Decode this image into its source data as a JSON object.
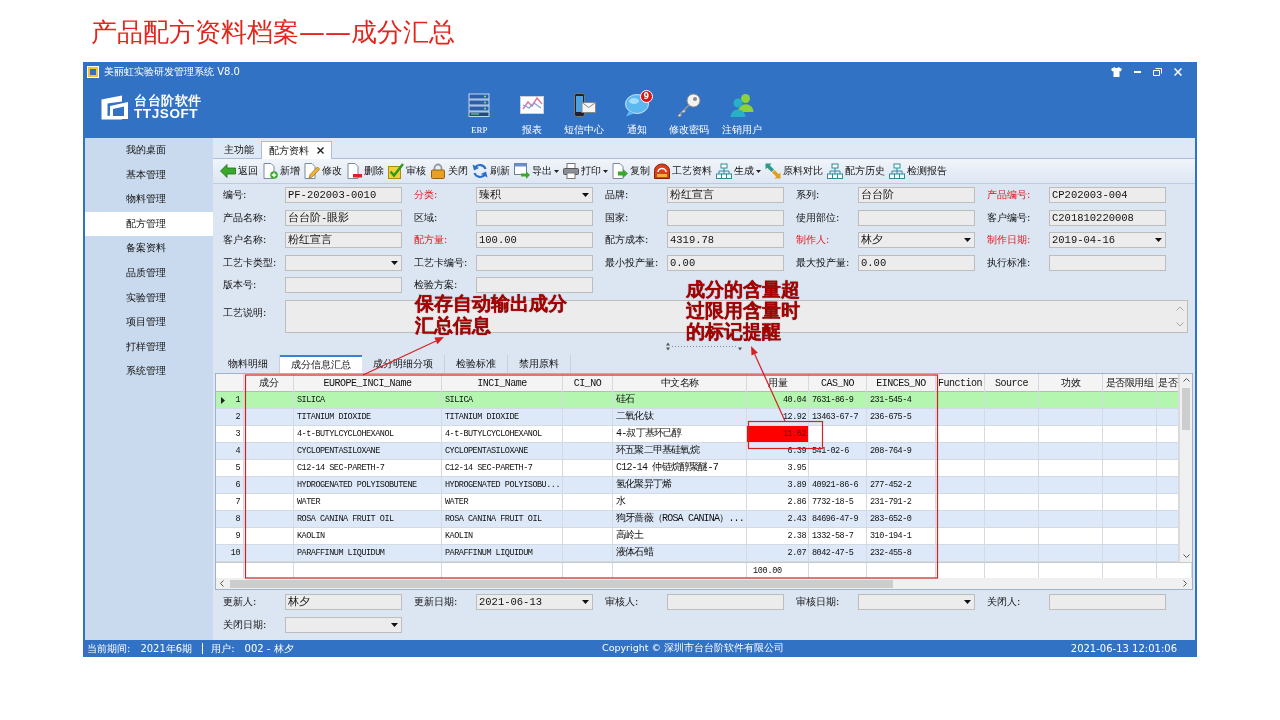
{
  "slide_title": "产品配方资料档案——成分汇总",
  "window": {
    "title": "美丽虹实验研发管理系统 V8.0"
  },
  "header": {
    "logo_name": "台台阶软件",
    "logo_latin": "TTJSOFT",
    "shortcuts": [
      {
        "label": "ERP"
      },
      {
        "label": "报表"
      },
      {
        "label": "短信中心"
      },
      {
        "label": "通知",
        "badge": "9"
      },
      {
        "label": "修改密码"
      },
      {
        "label": "注销用户"
      }
    ]
  },
  "sidebar": {
    "items": [
      {
        "label": "我的桌面",
        "selected": false
      },
      {
        "label": "基本管理",
        "selected": false
      },
      {
        "label": "物料管理",
        "selected": false
      },
      {
        "label": "配方管理",
        "selected": true
      },
      {
        "label": "备案资料",
        "selected": false
      },
      {
        "label": "品质管理",
        "selected": false
      },
      {
        "label": "实验管理",
        "selected": false
      },
      {
        "label": "项目管理",
        "selected": false
      },
      {
        "label": "打样管理",
        "selected": false
      },
      {
        "label": "系统管理",
        "selected": false
      }
    ]
  },
  "tabs": [
    {
      "label": "主功能",
      "selected": false,
      "closable": false
    },
    {
      "label": "配方资料",
      "selected": true,
      "closable": true
    }
  ],
  "toolbar": [
    {
      "label": "返回",
      "dropdown": false
    },
    {
      "label": "新增",
      "dropdown": false
    },
    {
      "label": "修改",
      "dropdown": false
    },
    {
      "label": "删除",
      "dropdown": false
    },
    {
      "label": "审核",
      "dropdown": false
    },
    {
      "label": "关闭",
      "dropdown": false
    },
    {
      "label": "刷新",
      "dropdown": false
    },
    {
      "label": "导出",
      "dropdown": true
    },
    {
      "label": "打印",
      "dropdown": true
    },
    {
      "label": "复制",
      "dropdown": false
    },
    {
      "label": "工艺资料",
      "dropdown": false
    },
    {
      "label": "生成",
      "dropdown": true
    },
    {
      "label": "原料对比",
      "dropdown": false
    },
    {
      "label": "配方历史",
      "dropdown": false
    },
    {
      "label": "检测报告",
      "dropdown": false
    }
  ],
  "form": {
    "rows": [
      [
        {
          "label": "编号:",
          "required": false,
          "kind": "text",
          "value": "PF-202003-0010"
        },
        {
          "label": "分类:",
          "required": true,
          "kind": "dropdown",
          "value": "臻积"
        },
        {
          "label": "品牌:",
          "required": false,
          "kind": "text",
          "value": "粉红宣言"
        },
        {
          "label": "系列:",
          "required": false,
          "kind": "text",
          "value": "台台阶"
        },
        {
          "label": "产品编号:",
          "required": true,
          "kind": "text",
          "value": "CP202003-004"
        }
      ],
      [
        {
          "label": "产品名称:",
          "required": false,
          "kind": "text",
          "value": "台台阶-眼影"
        },
        {
          "label": "区域:",
          "required": false,
          "kind": "text"
        },
        {
          "label": "国家:",
          "required": false,
          "kind": "text"
        },
        {
          "label": "使用部位:",
          "required": false,
          "kind": "text"
        },
        {
          "label": "客户编号:",
          "required": false,
          "kind": "text",
          "value": "C201810220008"
        }
      ],
      [
        {
          "label": "客户名称:",
          "required": false,
          "kind": "text",
          "value": "粉红宣言"
        },
        {
          "label": "配方量:",
          "required": true,
          "kind": "text",
          "value": "100.00"
        },
        {
          "label": "配方成本:",
          "required": false,
          "kind": "text",
          "value": "4319.78"
        },
        {
          "label": "制作人:",
          "required": true,
          "kind": "dropdown",
          "value": "林夕"
        },
        {
          "label": "制作日期:",
          "required": true,
          "kind": "dropdown",
          "value": "2019-04-16"
        }
      ],
      [
        {
          "label": "工艺卡类型:",
          "required": false,
          "kind": "dropdown"
        },
        {
          "label": "工艺卡编号:",
          "required": false,
          "kind": "text"
        },
        {
          "label": "最小投产量:",
          "required": false,
          "kind": "text",
          "value": "0.00"
        },
        {
          "label": "最大投产量:",
          "required": false,
          "kind": "text",
          "value": "0.00"
        },
        {
          "label": "执行标准:",
          "required": false,
          "kind": "text"
        }
      ],
      [
        {
          "label": "版本号:",
          "required": false,
          "kind": "text"
        },
        {
          "label": "检验方案:",
          "required": false,
          "kind": "text"
        }
      ]
    ],
    "notes": {
      "label": "工艺说明:"
    }
  },
  "detail_tabs": [
    {
      "label": "物料明细",
      "selected": false
    },
    {
      "label": "成分信息汇总",
      "selected": true
    },
    {
      "label": "成分明细分项",
      "selected": false
    },
    {
      "label": "检验标准",
      "selected": false
    },
    {
      "label": "禁用原料",
      "selected": false
    }
  ],
  "grid": {
    "columns": [
      "成分",
      "EUROPE_INCI_Name",
      "INCI_Name",
      "CI_NO",
      "中文名称",
      "用量",
      "CAS_NO",
      "EINCES_NO",
      "Function",
      "Source",
      "功效",
      "是否限用组",
      "是否"
    ],
    "rows": [
      {
        "number": "1",
        "selected": true,
        "over_limit": false,
        "europe_inci_name": "SILICA",
        "inci_name": "SILICA",
        "chinese_name": "硅石",
        "amount": "40.04",
        "cas_no": "7631-86-9",
        "einecs_no": "231-545-4"
      },
      {
        "number": "2",
        "selected": false,
        "over_limit": false,
        "europe_inci_name": "TITANIUM DIOXIDE",
        "inci_name": "TITANIUM DIOXIDE",
        "chinese_name": "二氧化钛",
        "amount": "12.92",
        "cas_no": "13463-67-7",
        "einecs_no": "236-675-5"
      },
      {
        "number": "3",
        "selected": false,
        "over_limit": true,
        "europe_inci_name": "4-t-BUTYLCYCLOHEXANOL",
        "inci_name": "4-t-BUTYLCYCLOHEXANOL",
        "chinese_name": "4-叔丁基环己醇",
        "amount": "11.62"
      },
      {
        "number": "4",
        "selected": false,
        "over_limit": false,
        "europe_inci_name": "CYCLOPENTASILOXANE",
        "inci_name": "CYCLOPENTASILOXANE",
        "chinese_name": "环五聚二甲基硅氧烷",
        "amount": "6.39",
        "cas_no": "541-02-6",
        "einecs_no": "208-764-9"
      },
      {
        "number": "5",
        "selected": false,
        "over_limit": false,
        "europe_inci_name": "C12-14 SEC-PARETH-7",
        "inci_name": "C12-14 SEC-PARETH-7",
        "chinese_name": "C12-14 仲链烷醇聚醚-7",
        "amount": "3.95"
      },
      {
        "number": "6",
        "selected": false,
        "over_limit": false,
        "europe_inci_name": "HYDROGENATED POLYISOBUTENE",
        "inci_name": "HYDROGENATED POLYISOBU...",
        "chinese_name": "氢化聚异丁烯",
        "amount": "3.89",
        "cas_no": "40921-86-6",
        "einecs_no": "277-452-2"
      },
      {
        "number": "7",
        "selected": false,
        "over_limit": false,
        "europe_inci_name": "WATER",
        "inci_name": "WATER",
        "chinese_name": "水",
        "amount": "2.86",
        "cas_no": "7732-18-5",
        "einecs_no": "231-791-2"
      },
      {
        "number": "8",
        "selected": false,
        "over_limit": false,
        "europe_inci_name": "ROSA CANINA FRUIT OIL",
        "inci_name": "ROSA CANINA FRUIT OIL",
        "chinese_name": "狗牙蔷薇（ROSA CANINA）...",
        "amount": "2.43",
        "cas_no": "84696-47-9",
        "einecs_no": "283-652-0"
      },
      {
        "number": "9",
        "selected": false,
        "over_limit": false,
        "europe_inci_name": "KAOLIN",
        "inci_name": "KAOLIN",
        "chinese_name": "高岭土",
        "amount": "2.38",
        "cas_no": "1332-58-7",
        "einecs_no": "310-194-1"
      },
      {
        "number": "10",
        "selected": false,
        "over_limit": false,
        "europe_inci_name": "PARAFFINUM LIQUIDUM",
        "inci_name": "PARAFFINUM LIQUIDUM",
        "chinese_name": "液体石蜡",
        "amount": "2.07",
        "cas_no": "8042-47-5",
        "einecs_no": "232-455-8"
      }
    ],
    "footer": {
      "amount_total": "100.00"
    }
  },
  "bottom_form": {
    "rows": [
      [
        {
          "label": "更新人:",
          "required": false,
          "kind": "text",
          "value": "林夕"
        },
        {
          "label": "更新日期:",
          "required": false,
          "kind": "dropdown",
          "value": "2021-06-13"
        },
        {
          "label": "审核人:",
          "required": false,
          "kind": "text"
        },
        {
          "label": "审核日期:",
          "required": false,
          "kind": "dropdown"
        },
        {
          "label": "关闭人:",
          "required": false,
          "kind": "text"
        }
      ],
      [
        {
          "label": "关闭日期:",
          "required": false,
          "kind": "dropdown"
        }
      ]
    ]
  },
  "status_bar": {
    "period_label": "当前期间:",
    "period": "2021年6期",
    "user_label": "用户:",
    "user": "002 - 林夕",
    "copyright": "Copyright © 深圳市台台阶软件有限公司",
    "datetime": "2021-06-13 12:01:06"
  },
  "annotations": [
    {
      "text": "保存自动输出成分汇总信息"
    },
    {
      "text": "成分的含量超过限用含量时的标记提醒"
    }
  ]
}
